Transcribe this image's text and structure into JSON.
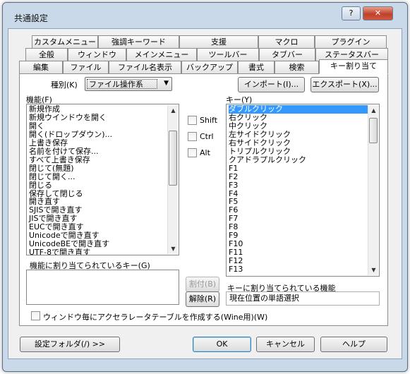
{
  "window": {
    "title": "共通設定",
    "help_glyph": "?",
    "close_glyph": "✕"
  },
  "tabs": {
    "row1": [
      "カスタムメニュー",
      "強調キーワード",
      "支援",
      "マクロ",
      "プラグイン"
    ],
    "row2": [
      "全般",
      "ウィンドウ",
      "メインメニュー",
      "ツールバー",
      "タブバー",
      "ステータスバー"
    ],
    "row3": [
      "編集",
      "ファイル",
      "ファイル名表示",
      "バックアップ",
      "書式",
      "検索",
      "キー割り当て"
    ],
    "active": "キー割り当て"
  },
  "type_select": {
    "label": "種別(K)",
    "value": "ファイル操作系"
  },
  "import_button": "インポート(I)...",
  "export_button": "エクスポート(X)...",
  "function_list": {
    "label": "機能(F)",
    "items": [
      "新規作成",
      "新規ウインドウを開く",
      "開く",
      "開く(ドロップダウン)...",
      "上書き保存",
      "名前を付けて保存...",
      "すべて上書き保存",
      "閉じて(無題)",
      "閉じて開く...",
      "閉じる",
      "保存して閉じる",
      "開き直す",
      "SJISで開き直す",
      "JISで開き直す",
      "EUCで開き直す",
      "Unicodeで開き直す",
      "UnicodeBEで開き直す",
      "UTF-8で開き直す"
    ]
  },
  "modifiers": {
    "shift": "Shift",
    "ctrl": "Ctrl",
    "alt": "Alt"
  },
  "key_list": {
    "label": "キー(Y)",
    "items": [
      "ダブルクリック",
      "右クリック",
      "中クリック",
      "左サイドクリック",
      "右サイドクリック",
      "トリプルクリック",
      "クアドラプルクリック",
      "F1",
      "F2",
      "F3",
      "F4",
      "F5",
      "F6",
      "F7",
      "F8",
      "F9",
      "F10",
      "F11",
      "F12",
      "F13"
    ],
    "selected_index": 0
  },
  "assigned_keys": {
    "label": "機能に割り当てられているキー(G)"
  },
  "assign_button": "割付(B)",
  "release_button": "解除(R)",
  "key_function": {
    "label": "キーに割り当てられている機能",
    "value": "現在位置の単語選択"
  },
  "accel_checkbox": {
    "label": "ウィンドウ毎にアクセラレータテーブルを作成する(Wine用)(W)"
  },
  "footer": {
    "settings_folder": "設定フォルダ(/) >>",
    "ok": "OK",
    "cancel": "キャンセル",
    "help": "ヘルプ"
  }
}
